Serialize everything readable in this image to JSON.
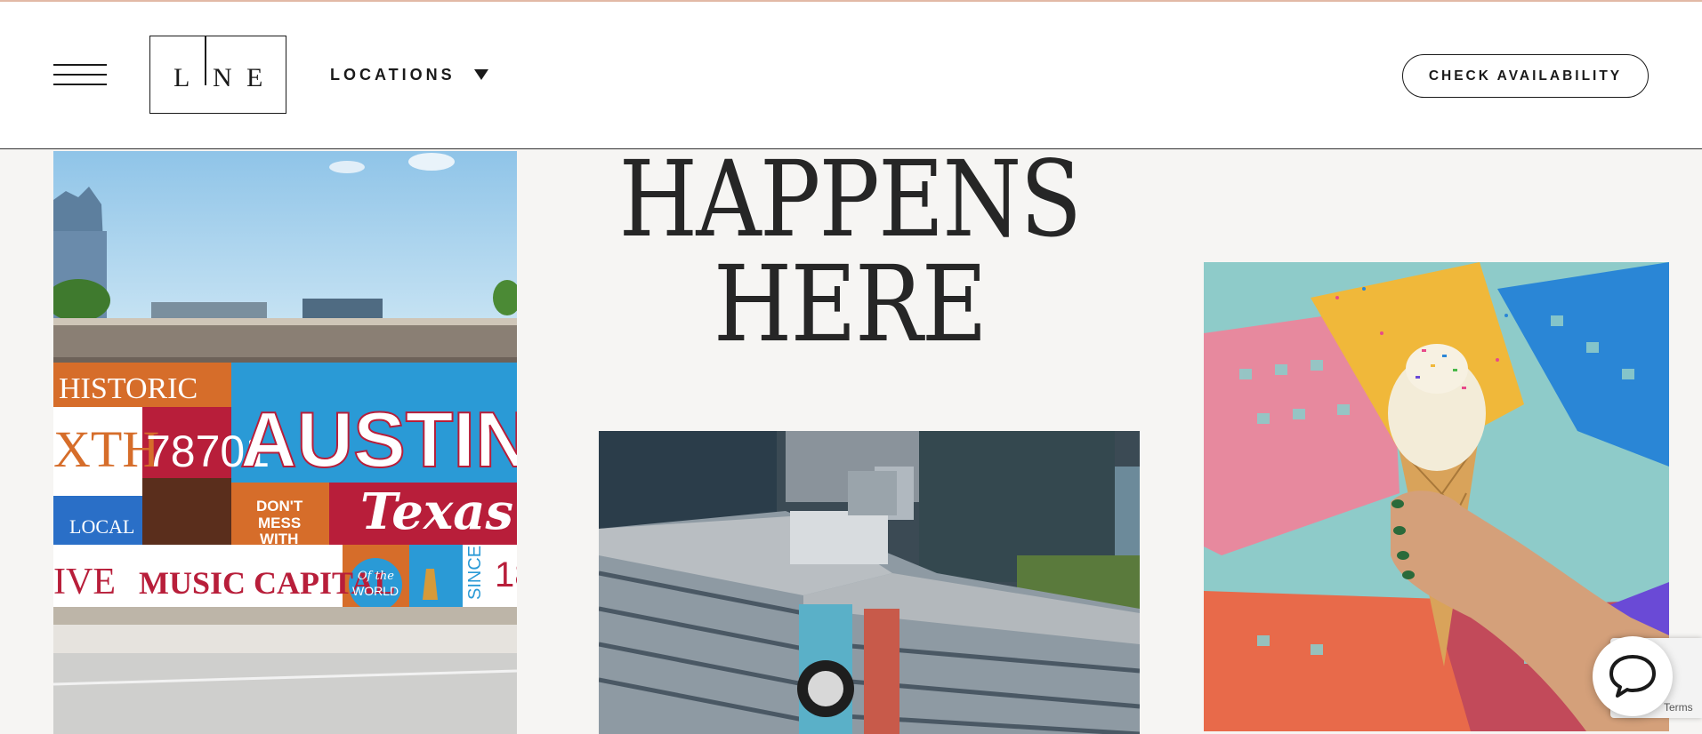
{
  "header": {
    "logo_letters": [
      "L",
      "N",
      "E"
    ],
    "nav_locations_label": "LOCATIONS",
    "cta_label": "CHECK AVAILABILITY"
  },
  "hero": {
    "headline_line1": "HAPPENS",
    "headline_line2": "HERE"
  },
  "mural": {
    "historic": "HISTORIC",
    "sixth": "XTH",
    "zip": "78701",
    "austin": "AUSTIN",
    "local": "LOCAL",
    "dont": "DON'T",
    "mess": "MESS",
    "with": "WITH",
    "texas": "Texas",
    "live": "IVE",
    "music_capital": "MUSIC CAPITAL",
    "of_the": "Of the",
    "world": "WORLD",
    "since": "SINCE",
    "since_year": "18"
  },
  "recaptcha": {
    "terms": "Terms"
  },
  "colors": {
    "accent_line": "#e2b9a6",
    "text": "#1a1a1a",
    "background": "#f6f5f3"
  },
  "icons": {
    "menu": "hamburger-icon",
    "dropdown": "caret-down-icon",
    "chat": "chat-bubble-icon"
  }
}
